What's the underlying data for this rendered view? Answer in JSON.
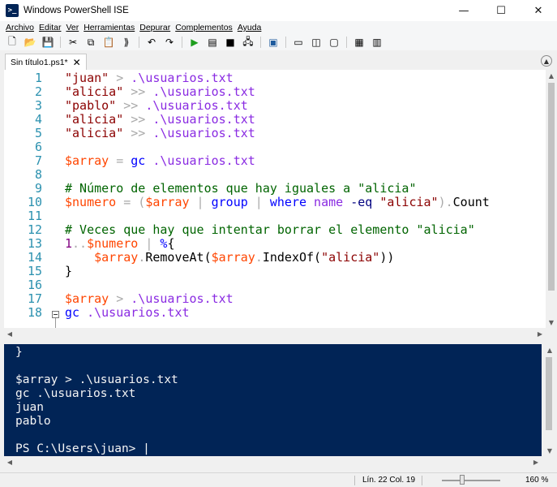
{
  "window": {
    "title": "Windows PowerShell ISE",
    "icon": "powershell-icon",
    "icon_glyph": ">_"
  },
  "window_controls": {
    "minimize": "—",
    "maximize": "☐",
    "close": "✕"
  },
  "menu": [
    "Archivo",
    "Editar",
    "Ver",
    "Herramientas",
    "Depurar",
    "Complementos",
    "Ayuda"
  ],
  "toolbar": [
    {
      "icon": "new-file-icon",
      "glyph": "🗋"
    },
    {
      "icon": "open-file-icon",
      "glyph": "📂"
    },
    {
      "icon": "save-icon",
      "glyph": "💾"
    },
    {
      "icon": "cut-icon",
      "glyph": "✂"
    },
    {
      "icon": "copy-icon",
      "glyph": "⧉"
    },
    {
      "icon": "paste-icon",
      "glyph": "📋"
    },
    {
      "icon": "clear-console-icon",
      "glyph": "⟫"
    },
    {
      "icon": "undo-icon",
      "glyph": "↶"
    },
    {
      "icon": "redo-icon",
      "glyph": "↷"
    },
    {
      "icon": "run-script-icon",
      "glyph": "▶",
      "color": "#1e9e1e"
    },
    {
      "icon": "run-selection-icon",
      "glyph": "▤"
    },
    {
      "icon": "stop-icon",
      "glyph": "■"
    },
    {
      "icon": "remote-powershell-icon",
      "glyph": "🖧"
    },
    {
      "icon": "start-powershell-icon",
      "glyph": "▣",
      "color": "#1e5b9e"
    },
    {
      "icon": "layout-top-icon",
      "glyph": "▭"
    },
    {
      "icon": "layout-right-icon",
      "glyph": "◫"
    },
    {
      "icon": "layout-max-icon",
      "glyph": "▢"
    },
    {
      "icon": "show-commands-icon",
      "glyph": "▦"
    },
    {
      "icon": "command-addon-icon",
      "glyph": "▥"
    }
  ],
  "tab": {
    "label": "Sin título1.ps1*",
    "close": "✕"
  },
  "editor": {
    "lines": [
      {
        "n": "1",
        "tokens": [
          {
            "t": "\"juan\"",
            "c": "t-str"
          },
          {
            "t": " > ",
            "c": "t-op"
          },
          {
            "t": ".\\usuarios.txt",
            "c": "t-path"
          }
        ]
      },
      {
        "n": "2",
        "tokens": [
          {
            "t": "\"alicia\"",
            "c": "t-str"
          },
          {
            "t": " >> ",
            "c": "t-op"
          },
          {
            "t": ".\\usuarios.txt",
            "c": "t-path"
          }
        ]
      },
      {
        "n": "3",
        "tokens": [
          {
            "t": "\"pablo\"",
            "c": "t-str"
          },
          {
            "t": " >> ",
            "c": "t-op"
          },
          {
            "t": ".\\usuarios.txt",
            "c": "t-path"
          }
        ]
      },
      {
        "n": "4",
        "tokens": [
          {
            "t": "\"alicia\"",
            "c": "t-str"
          },
          {
            "t": " >> ",
            "c": "t-op"
          },
          {
            "t": ".\\usuarios.txt",
            "c": "t-path"
          }
        ]
      },
      {
        "n": "5",
        "tokens": [
          {
            "t": "\"alicia\"",
            "c": "t-str"
          },
          {
            "t": " >> ",
            "c": "t-op"
          },
          {
            "t": ".\\usuarios.txt",
            "c": "t-path"
          }
        ]
      },
      {
        "n": "6",
        "tokens": []
      },
      {
        "n": "7",
        "tokens": [
          {
            "t": "$array",
            "c": "t-var"
          },
          {
            "t": " = ",
            "c": "t-op"
          },
          {
            "t": "gc",
            "c": "t-cmd"
          },
          {
            "t": " .\\usuarios.txt",
            "c": "t-path"
          }
        ]
      },
      {
        "n": "8",
        "tokens": []
      },
      {
        "n": "9",
        "tokens": [
          {
            "t": "# Número de elementos que hay iguales a \"alicia\"",
            "c": "t-cmt"
          }
        ]
      },
      {
        "n": "10",
        "tokens": [
          {
            "t": "$numero",
            "c": "t-var"
          },
          {
            "t": " = (",
            "c": "t-op"
          },
          {
            "t": "$array",
            "c": "t-var"
          },
          {
            "t": " | ",
            "c": "t-op"
          },
          {
            "t": "group",
            "c": "t-cmd"
          },
          {
            "t": " | ",
            "c": "t-op"
          },
          {
            "t": "where",
            "c": "t-cmd"
          },
          {
            "t": " name",
            "c": "t-path"
          },
          {
            "t": " -eq",
            "c": "t-param"
          },
          {
            "t": " \"alicia\"",
            "c": "t-str"
          },
          {
            "t": ").",
            "c": "t-op"
          },
          {
            "t": "Count",
            "c": "t-prop"
          }
        ]
      },
      {
        "n": "11",
        "tokens": []
      },
      {
        "n": "12",
        "tokens": [
          {
            "t": "# Veces que hay que intentar borrar el elemento \"alicia\"",
            "c": "t-cmt"
          }
        ]
      },
      {
        "n": "13",
        "tokens": [
          {
            "t": "1",
            "c": "t-num"
          },
          {
            "t": "..",
            "c": "t-op"
          },
          {
            "t": "$numero",
            "c": "t-var"
          },
          {
            "t": " | ",
            "c": "t-op"
          },
          {
            "t": "%",
            "c": "t-cmd"
          },
          {
            "t": "{",
            "c": "t-prop"
          }
        ]
      },
      {
        "n": "14",
        "tokens": [
          {
            "t": "    ",
            "c": "t-prop"
          },
          {
            "t": "$array",
            "c": "t-var"
          },
          {
            "t": ".",
            "c": "t-op"
          },
          {
            "t": "RemoveAt(",
            "c": "t-prop"
          },
          {
            "t": "$array",
            "c": "t-var"
          },
          {
            "t": ".",
            "c": "t-op"
          },
          {
            "t": "IndexOf(",
            "c": "t-prop"
          },
          {
            "t": "\"alicia\"",
            "c": "t-str"
          },
          {
            "t": "))",
            "c": "t-prop"
          }
        ]
      },
      {
        "n": "15",
        "tokens": [
          {
            "t": "}",
            "c": "t-prop"
          }
        ]
      },
      {
        "n": "16",
        "tokens": []
      },
      {
        "n": "17",
        "tokens": [
          {
            "t": "$array",
            "c": "t-var"
          },
          {
            "t": " > ",
            "c": "t-op"
          },
          {
            "t": ".\\usuarios.txt",
            "c": "t-path"
          }
        ]
      },
      {
        "n": "18",
        "tokens": [
          {
            "t": "gc",
            "c": "t-cmd"
          },
          {
            "t": " .\\usuarios.txt",
            "c": "t-path"
          }
        ]
      }
    ]
  },
  "console": {
    "lines": [
      "}",
      "",
      "$array > .\\usuarios.txt",
      "gc .\\usuarios.txt",
      "juan",
      "pablo",
      "",
      "PS C:\\Users\\juan> |"
    ]
  },
  "status": {
    "position": "Lín. 22  Col. 19",
    "zoom": "160 %",
    "zoom_value_percent": 160
  },
  "colors": {
    "console_bg": "#012456",
    "line_number": "#2b91af"
  }
}
